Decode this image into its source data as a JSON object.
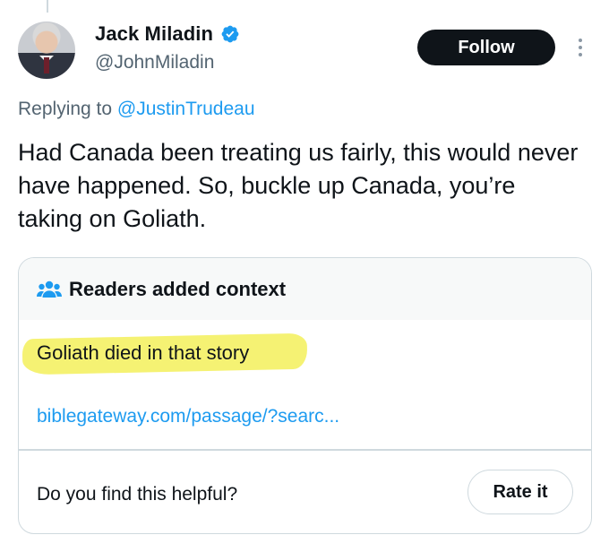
{
  "author": {
    "display_name": "Jack Miladin",
    "handle": "@JohnMiladin",
    "verified_icon": "verified-badge-icon",
    "verified_color": "#1d9bf0"
  },
  "actions": {
    "follow_label": "Follow",
    "more_icon": "vertical-ellipsis-icon"
  },
  "reply": {
    "prefix": "Replying to ",
    "target": "@JustinTrudeau"
  },
  "tweet": {
    "text": "Had Canada been treating us fairly, this would never have happened. So, buckle up Canada, you’re taking on Goliath."
  },
  "community_note": {
    "header_icon": "readers-group-icon",
    "title": "Readers added context",
    "text": "Goliath died in that story",
    "link": "biblegateway.com/passage/?searc...",
    "helpful_question": "Do you find this helpful?",
    "rate_label": "Rate it"
  },
  "colors": {
    "accent": "#1d9bf0",
    "text": "#0f1419",
    "muted": "#536471",
    "highlight": "#f3f05a",
    "follow_bg": "#0f1419"
  }
}
